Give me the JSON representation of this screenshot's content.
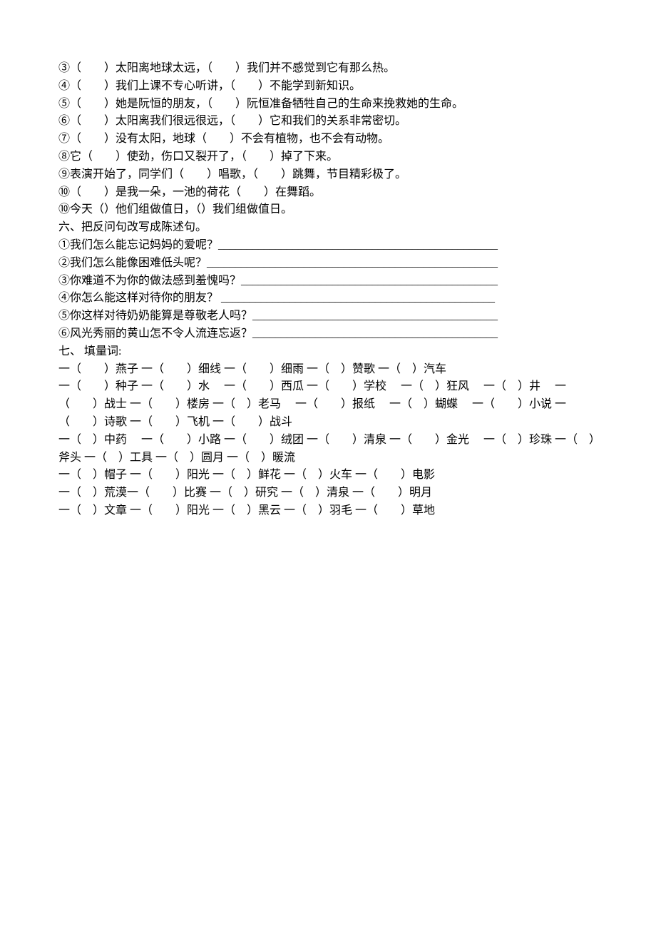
{
  "lines": [
    "③（　　）太阳离地球太远，（　　）我们并不感觉到它有那么热。",
    "④（　　）我们上课不专心听讲，（　　）不能学到新知识。",
    "⑤（　　）她是阮恒的朋友，（　　）阮恒准备牺牲自己的生命来挽救她的生命。",
    "⑥（　　）太阳离我们很远很远，（　　）它和我们的关系非常密切。",
    "⑦（　　）没有太阳，地球（　　）不会有植物，也不会有动物。",
    "⑧它（　　）使劲，伤口又裂开了，（　　）掉了下来。",
    "⑨表演开始了，同学们（　　）唱歌，（　　）跳舞，节目精彩极了。",
    "⑩（　　）是我一朵，一池的荷花（　　）在舞蹈。",
    "⑩今天（）他们组做值日，（）我们组做值日。",
    "六、把反问句改写成陈述句。",
    "①我们怎么能忘记妈妈的爱呢？_________________________________________________",
    "②我们怎么能像困难低头呢？___________________________________________________",
    "③你难道不为你的做法感到羞愧吗？_____________________________________________",
    "④你怎么能这样对待你的朋友？ ________________________________________________",
    "⑤你这样对待奶奶能算是尊敬老人吗？___________________________________________",
    "⑥风光秀丽的黄山怎不令人流连忘返？___________________________________________",
    "七、 填量词:",
    "一（　　）燕子 一（　　）细线 一（　　）细雨 一（　）赞歌 一（　）汽车",
    "一（　　）种子 一（　　）水　 一（　　）西瓜 一（　　）学校　 一（　）狂风　 一（　）井　 一（　　）战士 一（　　）楼房 一（　）老马　 一（　　）报纸　 一（　）蝴蝶　 一（　　）小说 一（　　）诗歌 一（　　）飞机 一（　　）战斗",
    "一（　）中药　 一（　　）小路 一（　　）绒团 一（　　）清泉 一（　　）金光　 一（　）珍珠 一（　）斧头 一（　）工具 一（　）圆月 一（　）暖流",
    "一（　）帽子 一（　　）阳光 一（　）鲜花 一（　）火车 一（　　）电影",
    "一（　）荒漠一（　　）比赛 一（　）研究 一（　）清泉 一（　　）明月",
    "一（　）文章 一（　　）阳光 一（　）黑云 一（　）羽毛 一（　　）草地"
  ]
}
